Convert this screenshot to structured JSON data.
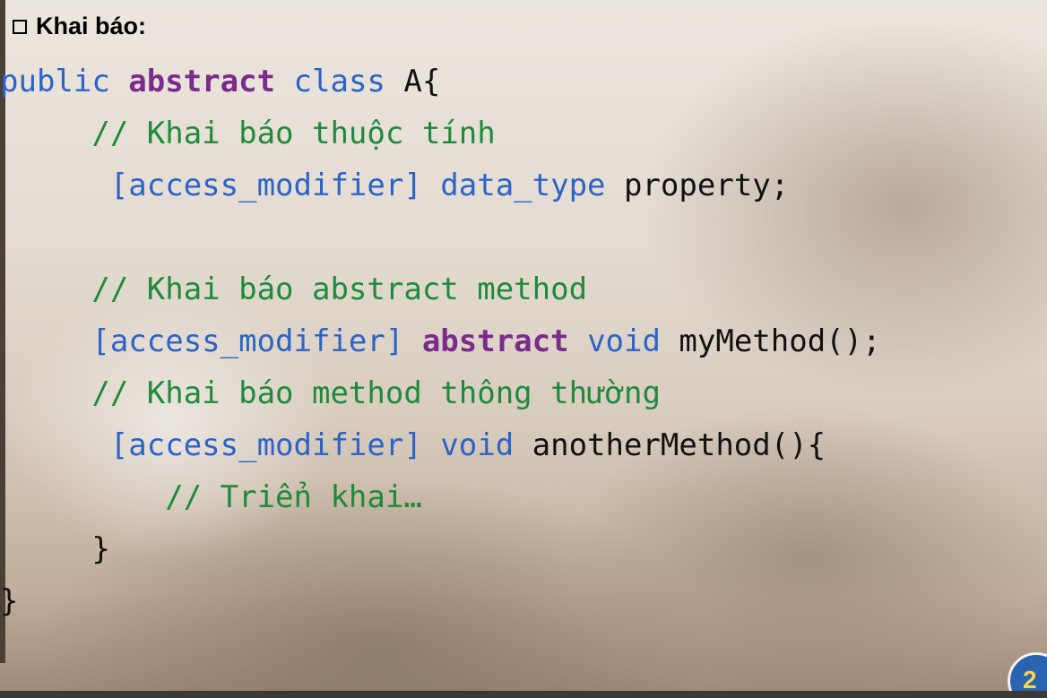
{
  "heading": {
    "marker": "❑",
    "label": "Khai báo:"
  },
  "code_lines": [
    {
      "indent": "",
      "tokens": [
        {
          "text": "public ",
          "style": "kw"
        },
        {
          "text": "abstract",
          "style": "kw2"
        },
        {
          "text": " class ",
          "style": "kw"
        },
        {
          "text": "A{",
          "style": "tx"
        }
      ]
    },
    {
      "indent": "     ",
      "tokens": [
        {
          "text": "// Khai báo thuộc tính",
          "style": "cm"
        }
      ]
    },
    {
      "indent": "      ",
      "tokens": [
        {
          "text": "[access_modifier] data_type ",
          "style": "kw"
        },
        {
          "text": "property;",
          "style": "tx"
        }
      ]
    },
    {
      "indent": "",
      "tokens": []
    },
    {
      "indent": "     ",
      "tokens": [
        {
          "text": "// Khai báo abstract method",
          "style": "cm"
        }
      ]
    },
    {
      "indent": "     ",
      "tokens": [
        {
          "text": "[access_modifier] ",
          "style": "kw"
        },
        {
          "text": "abstract",
          "style": "kw2"
        },
        {
          "text": " void ",
          "style": "kw"
        },
        {
          "text": "myMethod();",
          "style": "tx"
        }
      ]
    },
    {
      "indent": "     ",
      "tokens": [
        {
          "text": "// Khai báo method thông thường",
          "style": "cm"
        }
      ]
    },
    {
      "indent": "      ",
      "tokens": [
        {
          "text": "[access_modifier] void ",
          "style": "kw"
        },
        {
          "text": "anotherMethod(){",
          "style": "tx"
        }
      ]
    },
    {
      "indent": "         ",
      "tokens": [
        {
          "text": "// Triển khai…",
          "style": "cm"
        }
      ]
    },
    {
      "indent": "     ",
      "tokens": [
        {
          "text": "}",
          "style": "tx"
        }
      ]
    },
    {
      "indent": "",
      "tokens": [
        {
          "text": "}",
          "style": "tx"
        }
      ]
    }
  ],
  "page_number": "2",
  "colors": {
    "keyword": "#2b63c7",
    "abstract_keyword": "#7a2b8c",
    "comment": "#1f8a3a",
    "text": "#111111",
    "badge": "#2a63b0"
  }
}
